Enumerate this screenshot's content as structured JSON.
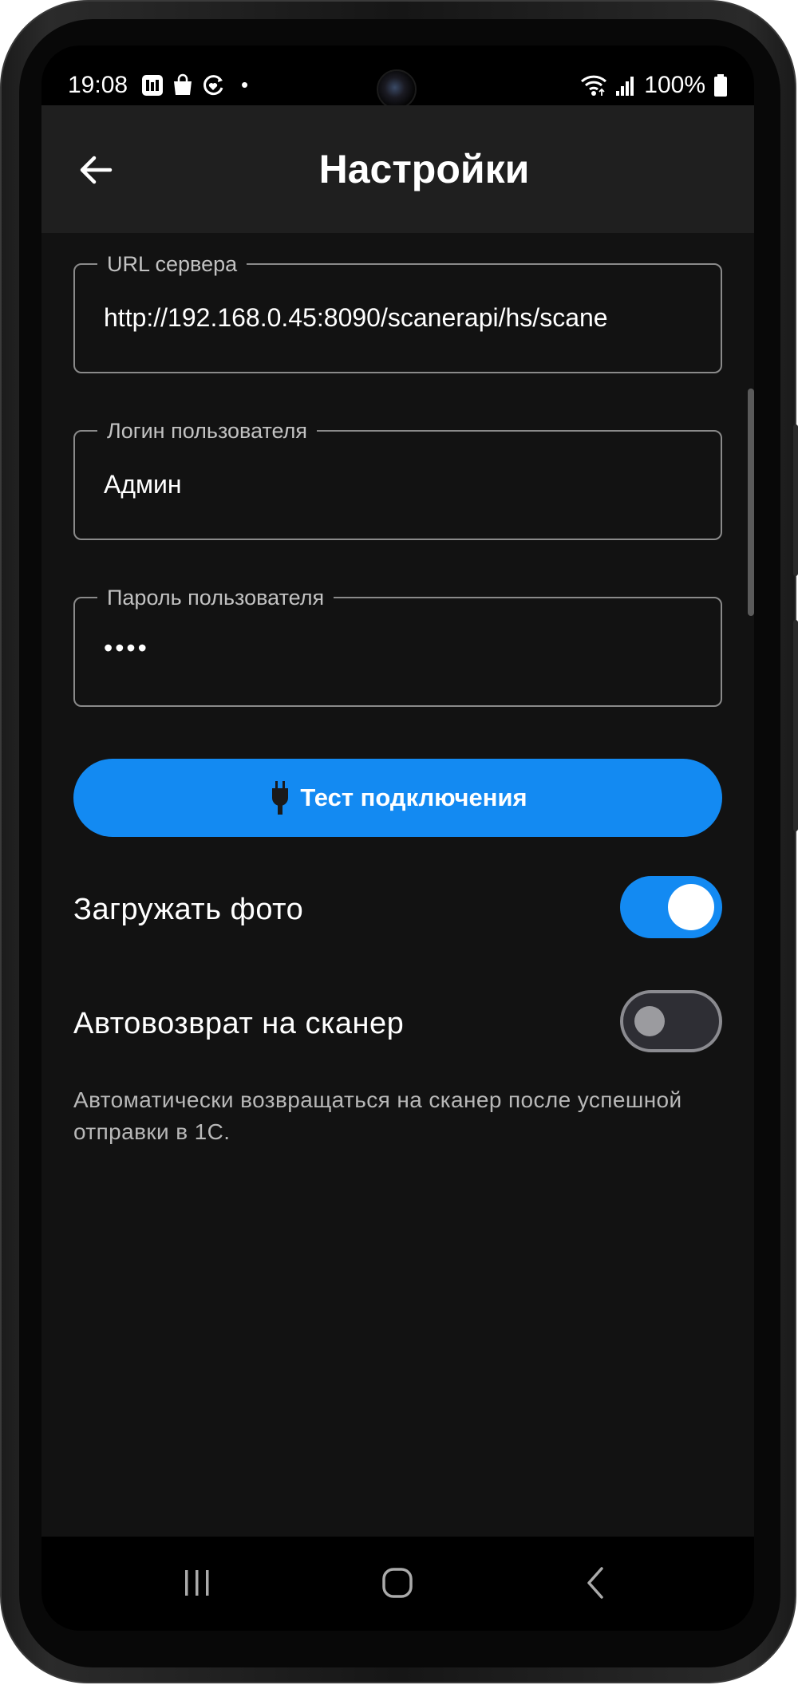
{
  "status_bar": {
    "time": "19:08",
    "dot": "•",
    "battery_percent": "100%",
    "left_icons": [
      "sim-card-icon",
      "shopping-bag-icon",
      "heart-sync-icon"
    ],
    "right_icons": [
      "wifi-icon",
      "signal-icon",
      "battery-icon"
    ]
  },
  "app_bar": {
    "title": "Настройки",
    "back_icon": "arrow-left-icon"
  },
  "form": {
    "server_url": {
      "label": "URL сервера",
      "value": "http://192.168.0.45:8090/scanerapi/hs/scane"
    },
    "login": {
      "label": "Логин пользователя",
      "value": "Админ"
    },
    "password": {
      "label": "Пароль пользователя",
      "value": "••••"
    },
    "test_button": {
      "label": "Тест подключения",
      "icon": "plug-icon"
    }
  },
  "toggles": {
    "upload_photo": {
      "label": "Загружать фото",
      "checked": true
    },
    "auto_return": {
      "label": "Автовозврат на сканер",
      "checked": false
    }
  },
  "help": {
    "text": "Автоматически возвращаться на сканер после успешной отправки в 1С."
  },
  "colors": {
    "accent": "#138af2",
    "background": "#121212",
    "app_bar": "#1f1f1f"
  },
  "nav_bar": {
    "buttons": [
      "recent-apps-icon",
      "home-icon",
      "back-icon"
    ]
  }
}
